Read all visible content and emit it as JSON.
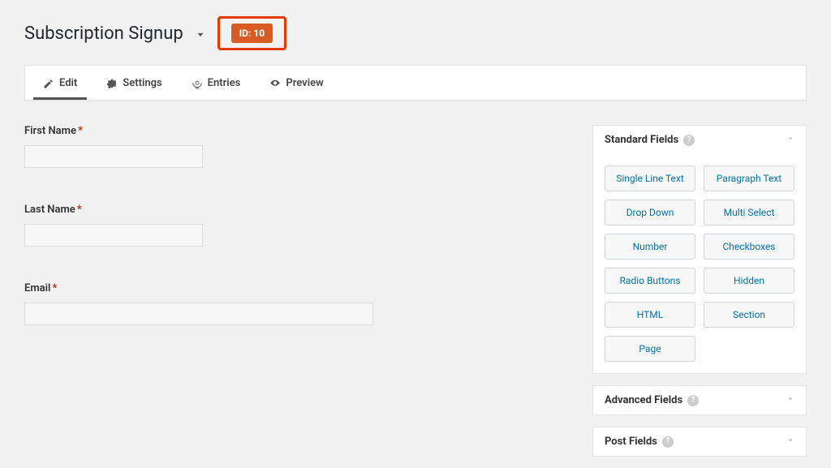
{
  "header": {
    "title": "Subscription Signup",
    "id_badge": "ID: 10"
  },
  "tabs": {
    "edit": "Edit",
    "settings": "Settings",
    "entries": "Entries",
    "preview": "Preview"
  },
  "fields": {
    "first_name": {
      "label": "First Name"
    },
    "last_name": {
      "label": "Last Name"
    },
    "email": {
      "label": "Email"
    }
  },
  "sidebar": {
    "standard": {
      "title": "Standard Fields",
      "items": [
        "Single Line Text",
        "Paragraph Text",
        "Drop Down",
        "Multi Select",
        "Number",
        "Checkboxes",
        "Radio Buttons",
        "Hidden",
        "HTML",
        "Section",
        "Page"
      ]
    },
    "advanced": {
      "title": "Advanced Fields"
    },
    "post": {
      "title": "Post Fields"
    }
  }
}
